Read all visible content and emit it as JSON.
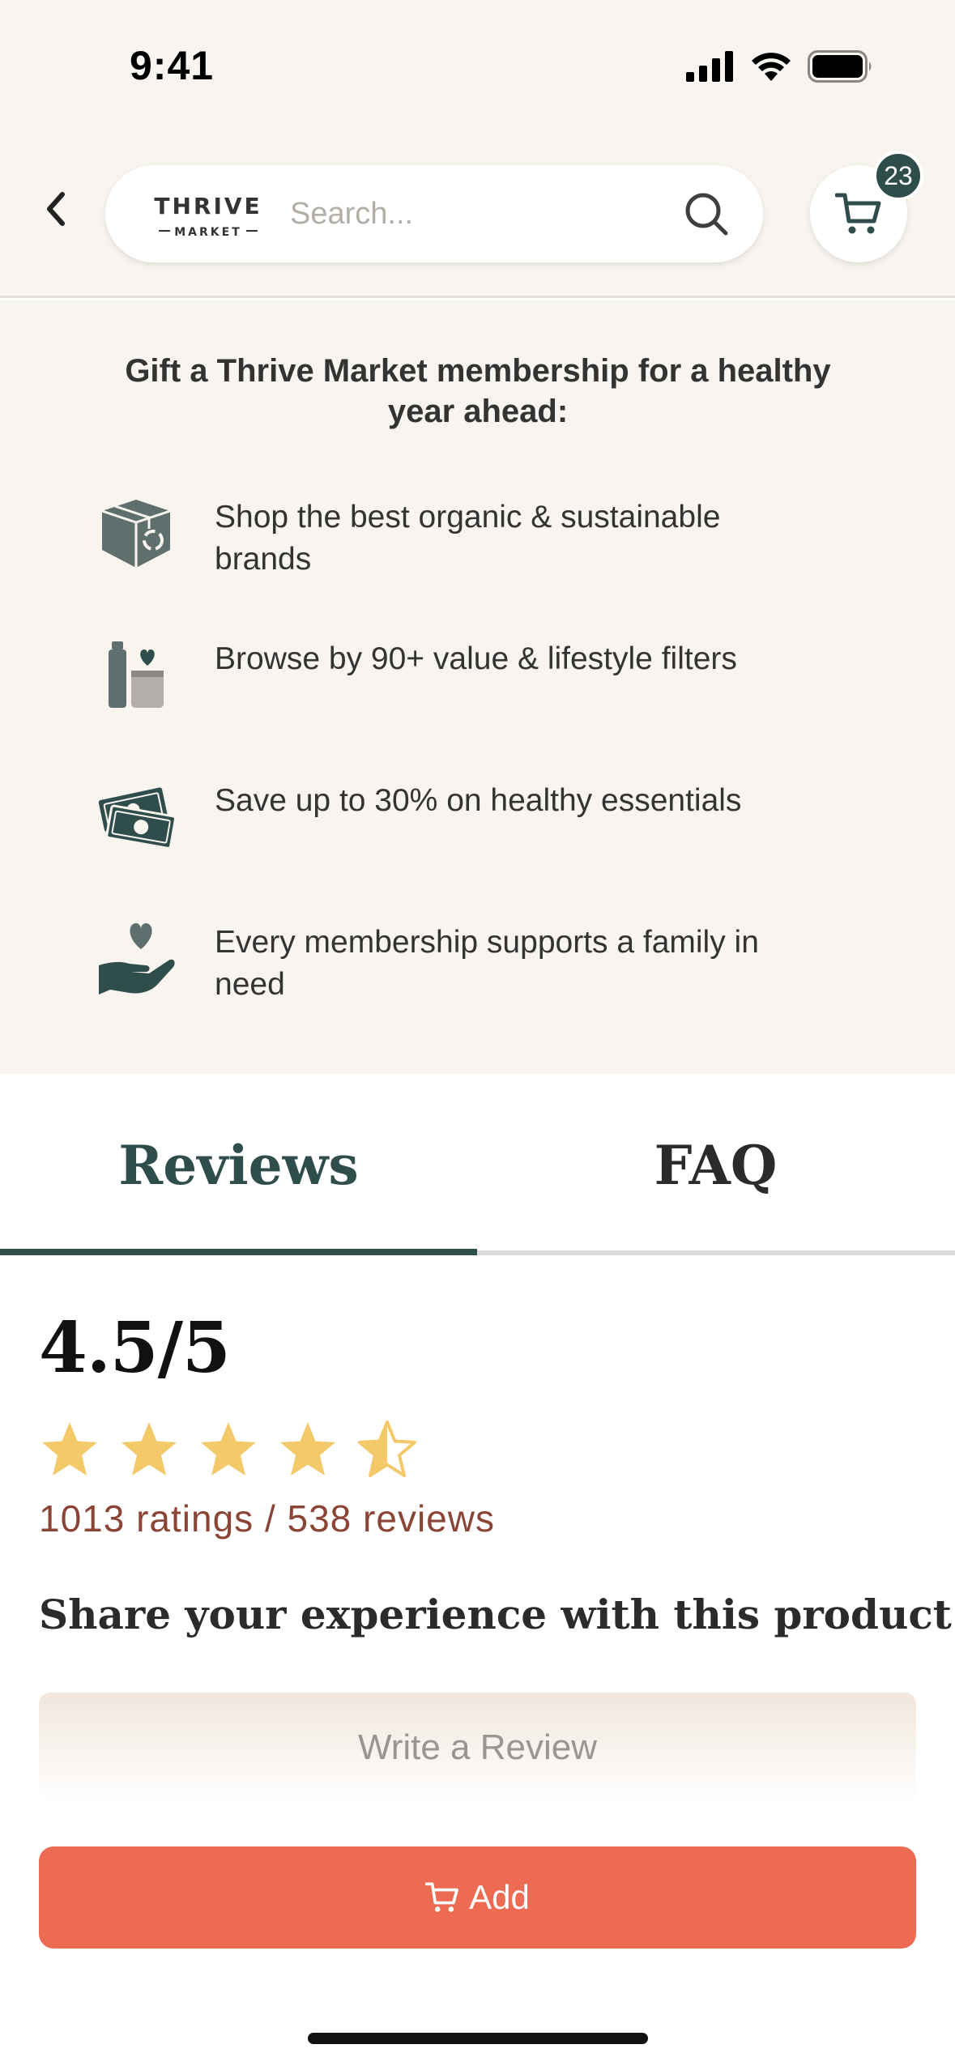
{
  "status_bar": {
    "time": "9:41"
  },
  "header": {
    "logo_top": "THRIVE",
    "logo_bottom": "MARKET",
    "search_placeholder": "Search...",
    "cart_count": "23"
  },
  "gift": {
    "title": "Gift a Thrive Market membership for a healthy year ahead:",
    "benefits": [
      {
        "icon": "box-icon",
        "text": "Shop the best organic & sustainable brands"
      },
      {
        "icon": "filters-icon",
        "text": "Browse by 90+ value & lifestyle filters"
      },
      {
        "icon": "money-icon",
        "text": "Save up to 30% on healthy essentials"
      },
      {
        "icon": "heart-hand-icon",
        "text": "Every membership supports a family in need"
      }
    ]
  },
  "tabs": [
    {
      "label": "Reviews",
      "active": true
    },
    {
      "label": "FAQ",
      "active": false
    }
  ],
  "reviews": {
    "score": "4.5/5",
    "rating_value": 4.5,
    "rating_max": 5,
    "counts": "1013 ratings / 538 reviews",
    "share_heading": "Share your experience with this product",
    "write_review_label": "Write a Review"
  },
  "add_button": {
    "label": "Add"
  },
  "colors": {
    "accent_green": "#2f4d4a",
    "add_orange": "#ec6b52",
    "star_gold": "#f3c96a",
    "counts_brown": "#8a4536",
    "cream_bg": "#f8f4ef"
  }
}
